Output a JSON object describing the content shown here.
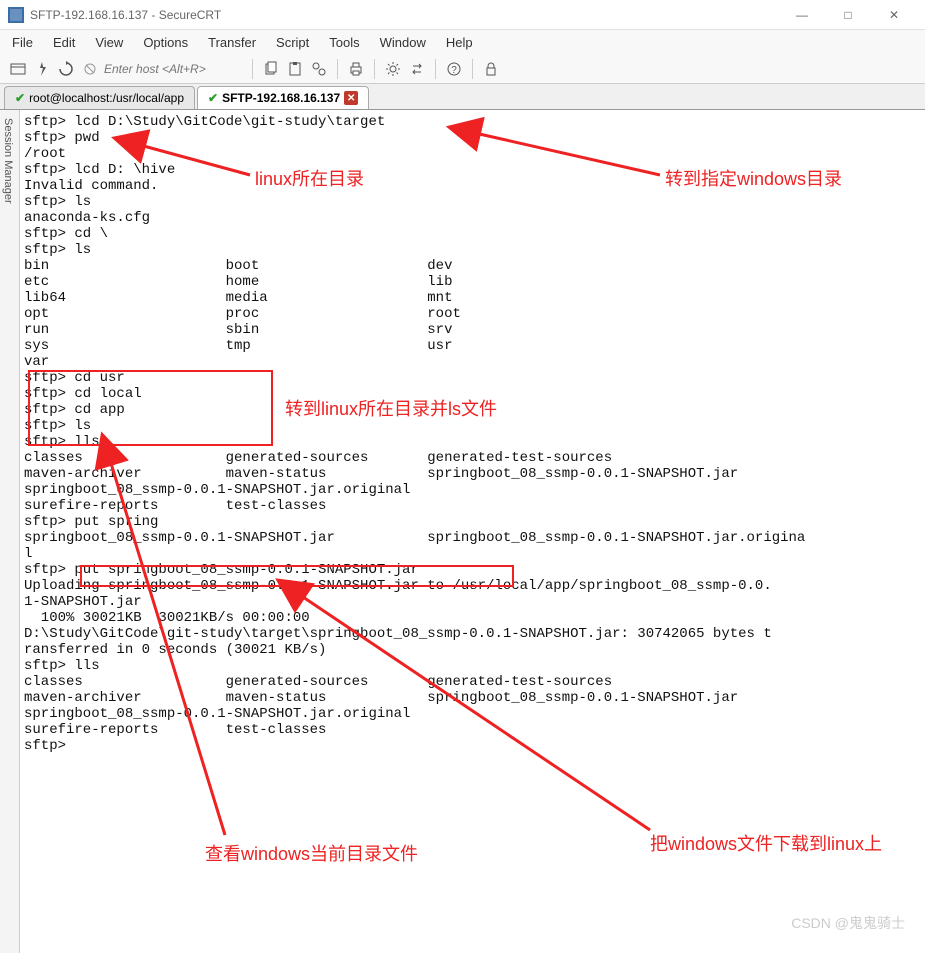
{
  "window": {
    "title": "SFTP-192.168.16.137 - SecureCRT",
    "min": "—",
    "max": "□",
    "close": "✕"
  },
  "menu": [
    "File",
    "Edit",
    "View",
    "Options",
    "Transfer",
    "Script",
    "Tools",
    "Window",
    "Help"
  ],
  "host_placeholder": "Enter host <Alt+R>",
  "tabs": [
    {
      "label": "root@localhost:/usr/local/app",
      "active": false
    },
    {
      "label": "SFTP-192.168.16.137",
      "active": true
    }
  ],
  "sidebar": "Session Manager",
  "terminal_lines": [
    "sftp> lcd D:\\Study\\GitCode\\git-study\\target",
    "sftp> pwd",
    "/root",
    "sftp> lcd D: \\hive",
    "Invalid command.",
    "sftp> ls",
    "anaconda-ks.cfg",
    "sftp> cd \\",
    "sftp> ls",
    "bin                     boot                    dev",
    "etc                     home                    lib",
    "lib64                   media                   mnt",
    "opt                     proc                    root",
    "run                     sbin                    srv",
    "sys                     tmp                     usr",
    "var",
    "sftp> cd usr",
    "sftp> cd local",
    "sftp> cd app",
    "sftp> ls",
    "sftp> lls",
    "classes                 generated-sources       generated-test-sources",
    "maven-archiver          maven-status            springboot_08_ssmp-0.0.1-SNAPSHOT.jar",
    "springboot_08_ssmp-0.0.1-SNAPSHOT.jar.original",
    "surefire-reports        test-classes",
    "sftp> put spring",
    "springboot_08_ssmp-0.0.1-SNAPSHOT.jar           springboot_08_ssmp-0.0.1-SNAPSHOT.jar.origina",
    "l",
    "sftp> put springboot_08_ssmp-0.0.1-SNAPSHOT.jar",
    "Uploading springboot_08_ssmp-0.0.1-SNAPSHOT.jar to /usr/local/app/springboot_08_ssmp-0.0.",
    "1-SNAPSHOT.jar",
    "  100% 30021KB  30021KB/s 00:00:00",
    "D:\\Study\\GitCode\\git-study\\target\\springboot_08_ssmp-0.0.1-SNAPSHOT.jar: 30742065 bytes t",
    "ransferred in 0 seconds (30021 KB/s)",
    "sftp> lls",
    "classes                 generated-sources       generated-test-sources",
    "maven-archiver          maven-status            springboot_08_ssmp-0.0.1-SNAPSHOT.jar",
    "springboot_08_ssmp-0.0.1-SNAPSHOT.jar.original",
    "surefire-reports        test-classes",
    "sftp>"
  ],
  "annotations": {
    "a1": "linux所在目录",
    "a2": "转到指定windows目录",
    "a3": "转到linux所在目录并ls文件",
    "a4": "查看windows当前目录文件",
    "a5": "把windows文件下载到linux上"
  },
  "watermark": "CSDN @鬼鬼骑士"
}
